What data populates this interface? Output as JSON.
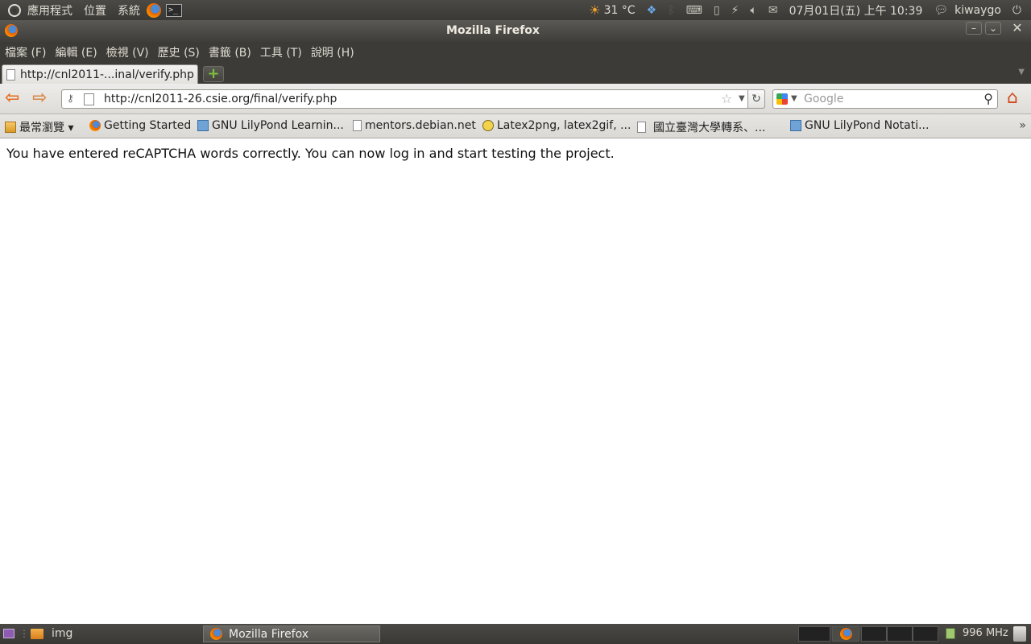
{
  "top_panel": {
    "menus": [
      "應用程式",
      "位置",
      "系統"
    ],
    "weather_temp": "31 °C",
    "datetime": "07月01日(五) 上午 10:39",
    "username": "kiwaygo"
  },
  "window": {
    "title": "Mozilla Firefox"
  },
  "menubar": {
    "items": [
      "檔案 (F)",
      "編輯 (E)",
      "檢視 (V)",
      "歷史 (S)",
      "書籤 (B)",
      "工具 (T)",
      "說明 (H)"
    ]
  },
  "tabs": [
    {
      "label": "http://cnl2011-...inal/verify.php"
    }
  ],
  "navbar": {
    "url": "http://cnl2011-26.csie.org/final/verify.php",
    "search_placeholder": "Google"
  },
  "bookmarks": [
    {
      "label": "最常瀏覽 ▾",
      "icon": "folder-icon"
    },
    {
      "label": "Getting Started",
      "icon": "firefox-icon"
    },
    {
      "label": "GNU LilyPond Learnin...",
      "icon": "lilypond-icon"
    },
    {
      "label": "mentors.debian.net",
      "icon": "page-icon"
    },
    {
      "label": "Latex2png, latex2gif, ...",
      "icon": "latex-icon"
    },
    {
      "label": "國立臺灣大學轉系、...",
      "icon": "page-icon"
    },
    {
      "label": "GNU LilyPond Notati...",
      "icon": "lilypond-icon"
    }
  ],
  "content": {
    "message": "You have entered reCAPTCHA words correctly. You can now log in and start testing the project."
  },
  "bottom_panel": {
    "tasks": [
      "img",
      "Mozilla Firefox"
    ],
    "cpu_freq": "996 MHz"
  },
  "colors": {
    "panel_bg": "#3c3b37",
    "back_arrow": "#e66d1e",
    "home_icon": "#d24a1c"
  }
}
